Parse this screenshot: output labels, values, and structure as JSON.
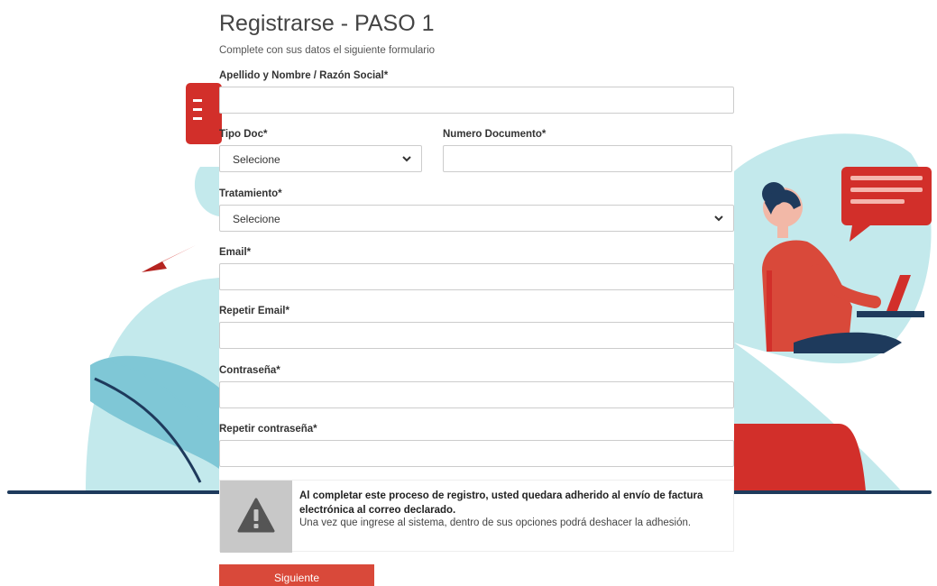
{
  "form": {
    "title": "Registrarse - PASO 1",
    "subtitle": "Complete con sus datos el siguiente formulario",
    "fields": {
      "name_label": "Apellido y Nombre / Razón Social*",
      "name_value": "",
      "doctype_label": "Tipo Doc*",
      "doctype_value": "Selecione",
      "docnum_label": "Numero Documento*",
      "docnum_value": "",
      "treatment_label": "Tratamiento*",
      "treatment_value": "Selecione",
      "email_label": "Email*",
      "email_value": "",
      "email_repeat_label": "Repetir Email*",
      "email_repeat_value": "",
      "password_label": "Contraseña*",
      "password_value": "",
      "password_repeat_label": "Repetir contraseña*",
      "password_repeat_value": ""
    },
    "notice": {
      "icon": "warning-icon",
      "strong": "Al completar este proceso de registro, usted quedara adherido al envío de factura electrónica al correo declarado.",
      "text": "Una vez que ingrese al sistema, dentro de sus opciones podrá deshacer la adhesión."
    },
    "submit_label": "Siguiente"
  },
  "colors": {
    "accent_red": "#d9493a",
    "illustration_blue": "#c3e9ec",
    "illustration_navy": "#1e3a5c"
  }
}
